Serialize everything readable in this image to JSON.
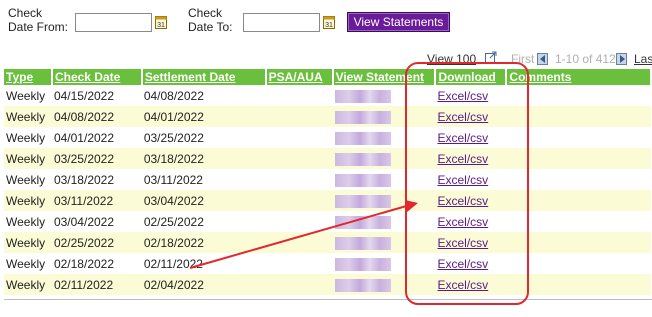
{
  "filters": {
    "from_label_line1": "Check",
    "from_label_line2": "Date From:",
    "from_value": "",
    "to_label_line1": "Check",
    "to_label_line2": "Date To:",
    "to_value": "",
    "calendar_icon_text": "31",
    "view_button": "View Statements"
  },
  "pager": {
    "view_label": "View 100",
    "first_label": "First",
    "range": "1-10 of 412",
    "last_label": "Last"
  },
  "table": {
    "columns": [
      "Type",
      "Check Date",
      "Settlement Date",
      "PSA/AUA",
      "View Statement",
      "Download",
      "Comments"
    ],
    "rows": [
      {
        "type": "Weekly",
        "check_date": "04/15/2022",
        "settlement_date": "04/08/2022",
        "download": "Excel/csv"
      },
      {
        "type": "Weekly",
        "check_date": "04/08/2022",
        "settlement_date": "04/01/2022",
        "download": "Excel/csv"
      },
      {
        "type": "Weekly",
        "check_date": "04/01/2022",
        "settlement_date": "03/25/2022",
        "download": "Excel/csv"
      },
      {
        "type": "Weekly",
        "check_date": "03/25/2022",
        "settlement_date": "03/18/2022",
        "download": "Excel/csv"
      },
      {
        "type": "Weekly",
        "check_date": "03/18/2022",
        "settlement_date": "03/11/2022",
        "download": "Excel/csv"
      },
      {
        "type": "Weekly",
        "check_date": "03/11/2022",
        "settlement_date": "03/04/2022",
        "download": "Excel/csv"
      },
      {
        "type": "Weekly",
        "check_date": "03/04/2022",
        "settlement_date": "02/25/2022",
        "download": "Excel/csv"
      },
      {
        "type": "Weekly",
        "check_date": "02/25/2022",
        "settlement_date": "02/18/2022",
        "download": "Excel/csv"
      },
      {
        "type": "Weekly",
        "check_date": "02/18/2022",
        "settlement_date": "02/11/2022",
        "download": "Excel/csv"
      },
      {
        "type": "Weekly",
        "check_date": "02/11/2022",
        "settlement_date": "02/04/2022",
        "download": "Excel/csv"
      }
    ]
  },
  "colors": {
    "header_green": "#6abf3c",
    "button_purple": "#6a1b9a",
    "link_purple": "#5a1a87",
    "alt_row": "#fbfbd6",
    "annotation_red": "#e0282e"
  },
  "icons": [
    "calendar-icon",
    "popout-icon",
    "prev-page-icon",
    "next-page-icon"
  ]
}
